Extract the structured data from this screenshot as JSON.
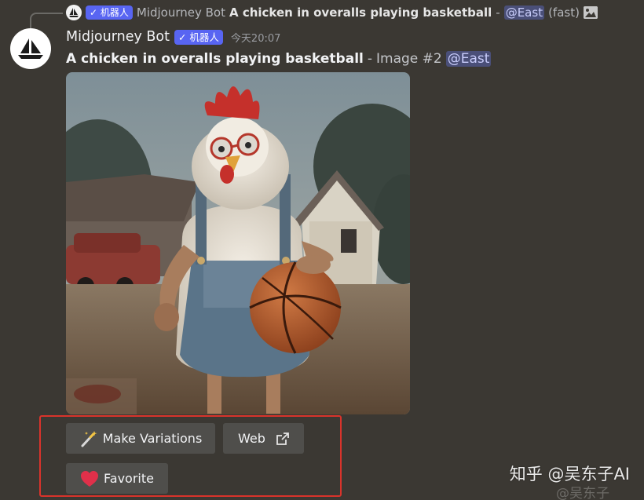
{
  "reply": {
    "bot_tag": "✓ 机器人",
    "author": "Midjourney Bot",
    "prompt": "A chicken in overalls playing basketball",
    "separator": "-",
    "mention": "@East",
    "speed": "(fast)",
    "attachment_icon": "image-icon"
  },
  "message": {
    "author": "Midjourney Bot",
    "bot_tag": "✓ 机器人",
    "timestamp": "今天20:07",
    "prompt": "A chicken in overalls playing basketball",
    "separator": "-",
    "image_label": "Image #2",
    "mention": "@East",
    "avatar_icon": "sailboat-icon",
    "image_description_icon": "generated-image"
  },
  "buttons": {
    "make_variations": {
      "label": "Make Variations",
      "icon": "magic-wand-icon"
    },
    "web": {
      "label": "Web",
      "icon": "external-link-icon"
    },
    "favorite": {
      "label": "Favorite",
      "icon": "heart-icon"
    }
  },
  "watermark": {
    "text": "知乎 @吴东子AI",
    "subtext": "@吴东子"
  },
  "colors": {
    "background": "#3b3833",
    "bot_tag": "#5865f2",
    "mention_bg": "#4a4f78",
    "button_bg": "#4f4e4b",
    "highlight_border": "#d9332b",
    "heart": "#e0304a"
  }
}
